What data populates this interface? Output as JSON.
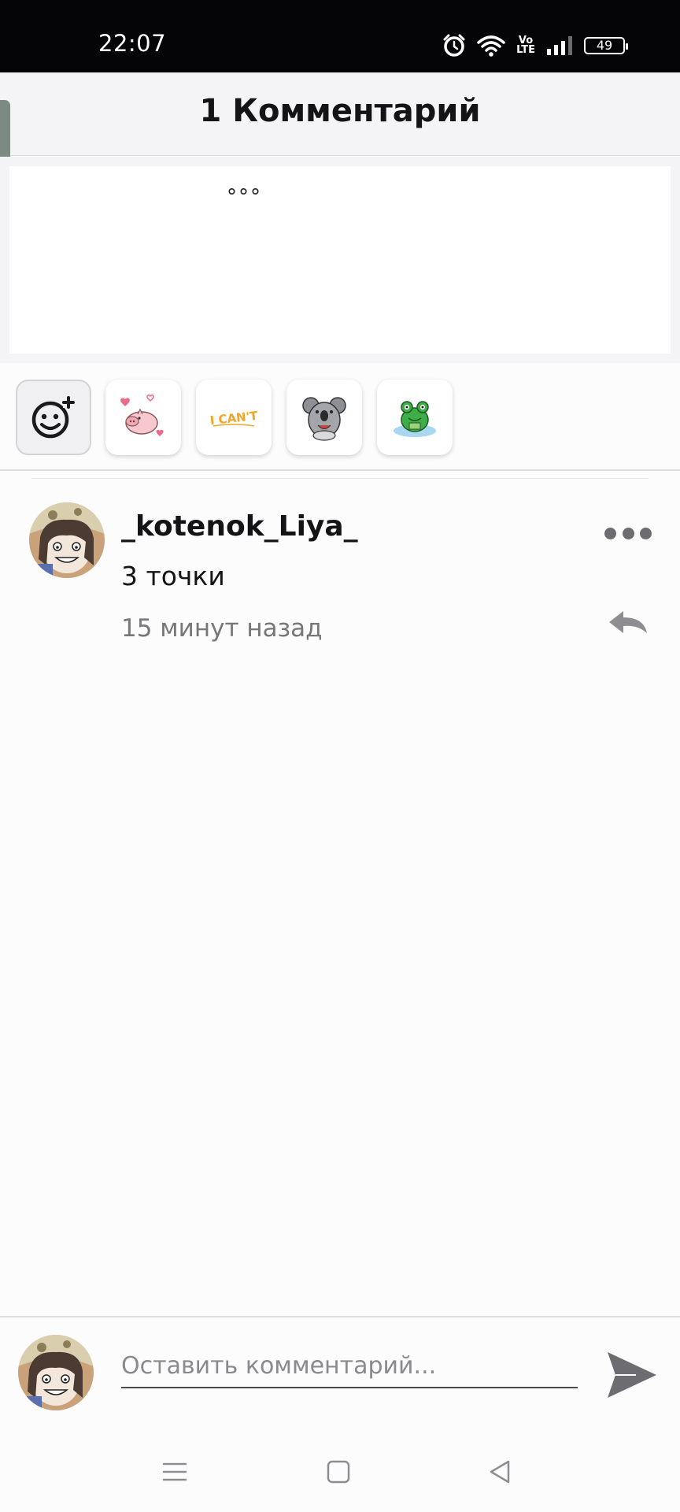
{
  "status_bar": {
    "time": "22:07",
    "volte_top": "Vo",
    "volte_bottom": "LTE",
    "battery": "49",
    "icons": [
      "alarm-icon",
      "wifi-icon",
      "volte-icon",
      "signal-icon",
      "battery-icon"
    ]
  },
  "header": {
    "title": "1 Комментарий"
  },
  "preview": {
    "text": "°°°"
  },
  "stickers": [
    {
      "name": "add-sticker",
      "icon": "smiley-plus-icon"
    },
    {
      "name": "pig-hearts-sticker",
      "icon": "pig-sticker-icon"
    },
    {
      "name": "i-cant-sticker",
      "icon": "i-cant-text-sticker-icon",
      "text": "I CAN'T"
    },
    {
      "name": "koala-sticker",
      "icon": "koala-sticker-icon"
    },
    {
      "name": "frog-sticker",
      "icon": "frog-sticker-icon"
    }
  ],
  "comment": {
    "author": "_kotenok_Liya_",
    "text": "3 точки",
    "time": "15 минут назад"
  },
  "input": {
    "placeholder": "Оставить комментарий..."
  },
  "colors": {
    "status_bar_bg": "#050406",
    "header_bg": "#f4f3f5",
    "page_bg": "#fdfcfd",
    "text_primary": "#141316",
    "text_secondary": "#77767a",
    "icon_gray": "#6d6c70",
    "handle": "#7b8b83"
  },
  "nav_bar": {
    "icons": [
      "menu-icon",
      "home-square-icon",
      "back-triangle-icon"
    ]
  }
}
